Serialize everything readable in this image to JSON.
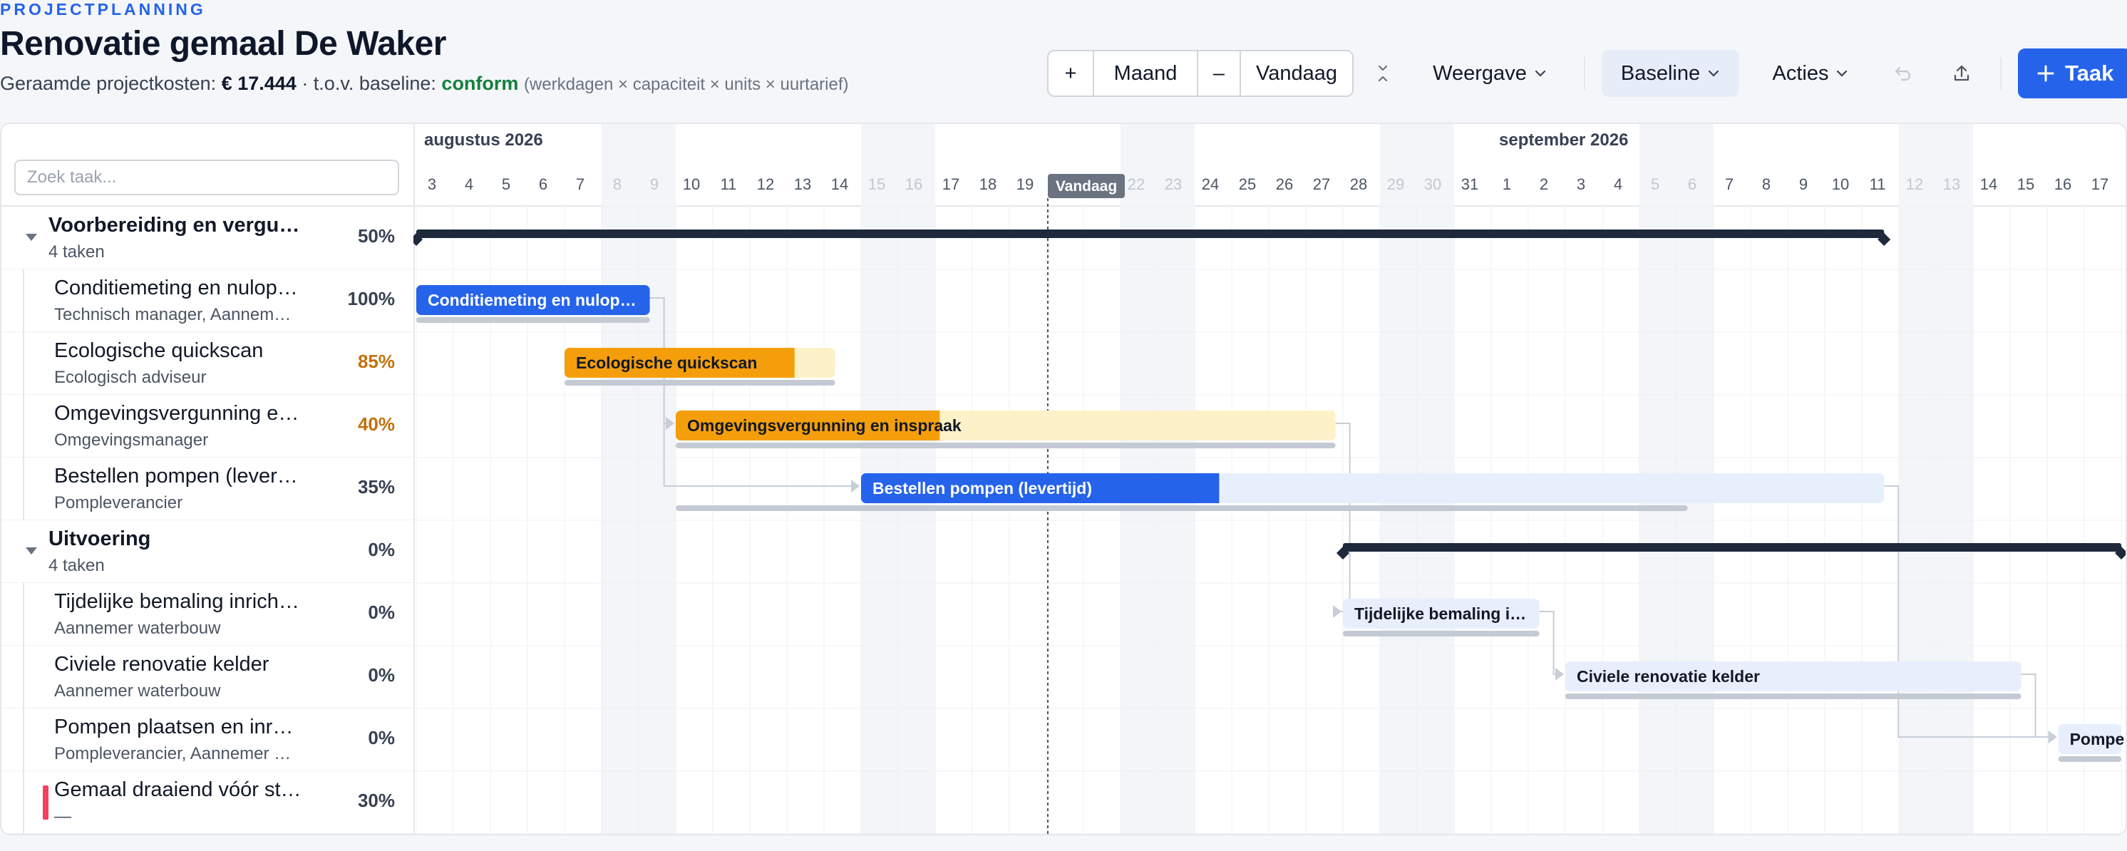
{
  "header": {
    "eyebrow": "PROJECTPLANNING",
    "title": "Renovatie gemaal De Waker",
    "cost_label": "Geraamde projectkosten:",
    "cost_value": "€ 17.444",
    "baseline_prefix": "· t.o.v. baseline:",
    "baseline_status": "conform",
    "formula_hint": "(werkdagen × capaciteit × units × uurtarief)"
  },
  "toolbar": {
    "zoom_in": "+",
    "zoom_level": "Maand",
    "zoom_out": "–",
    "today": "Vandaag",
    "view": "Weergave",
    "baseline": "Baseline",
    "actions": "Acties",
    "add_task": "Taak"
  },
  "search": {
    "placeholder": "Zoek taak..."
  },
  "rows": [
    {
      "kind": "group",
      "name": "Voorbereiding en vergun…",
      "sub": "4 taken",
      "pct": "50%",
      "pct_color": "#374151"
    },
    {
      "kind": "task",
      "name": "Conditiemeting en nulop…",
      "sub": "Technisch manager, Aannem…",
      "pct": "100%",
      "pct_color": "#374151"
    },
    {
      "kind": "task",
      "name": "Ecologische quickscan",
      "sub": "Ecologisch adviseur",
      "pct": "85%",
      "pct_color": "#c2710c"
    },
    {
      "kind": "task",
      "name": "Omgevingsvergunning e…",
      "sub": "Omgevingsmanager",
      "pct": "40%",
      "pct_color": "#c2710c"
    },
    {
      "kind": "task",
      "name": "Bestellen pompen (lever…",
      "sub": "Pompleverancier",
      "pct": "35%",
      "pct_color": "#374151"
    },
    {
      "kind": "group",
      "name": "Uitvoering",
      "sub": "4 taken",
      "pct": "0%",
      "pct_color": "#374151"
    },
    {
      "kind": "task",
      "name": "Tijdelijke bemaling inrich…",
      "sub": "Aannemer waterbouw",
      "pct": "0%",
      "pct_color": "#374151"
    },
    {
      "kind": "task",
      "name": "Civiele renovatie kelder",
      "sub": "Aannemer waterbouw",
      "pct": "0%",
      "pct_color": "#374151"
    },
    {
      "kind": "task",
      "name": "Pompen plaatsen en inre…",
      "sub": "Pompleverancier, Aannemer …",
      "pct": "0%",
      "pct_color": "#374151"
    },
    {
      "kind": "milestone",
      "name": "Gemaal draaiend vóór st…",
      "sub": "—",
      "pct": "30%",
      "pct_color": "#374151"
    }
  ],
  "timeline": {
    "months": [
      {
        "label": "augustus 2026",
        "start_index": 0
      },
      {
        "label": "september 2026",
        "start_index": 29
      }
    ],
    "days": [
      "3",
      "4",
      "5",
      "6",
      "7",
      "8",
      "9",
      "10",
      "11",
      "12",
      "13",
      "14",
      "15",
      "16",
      "17",
      "18",
      "19",
      "20",
      "21",
      "22",
      "23",
      "24",
      "25",
      "26",
      "27",
      "28",
      "29",
      "30",
      "31",
      "1",
      "2",
      "3",
      "4",
      "5",
      "6",
      "7",
      "8",
      "9",
      "10",
      "11",
      "12",
      "13",
      "14",
      "15",
      "16",
      "17"
    ],
    "weekend_indices": [
      5,
      6,
      12,
      13,
      19,
      20,
      26,
      27,
      33,
      34,
      40,
      41
    ],
    "today_index": 17,
    "today_label": "Vandaag",
    "bars": [
      {
        "row": 0,
        "type": "summary",
        "start": 0,
        "end": 39.6
      },
      {
        "row": 1,
        "type": "task",
        "label": "Conditiemeting en nulop…",
        "start": 0,
        "end": 6.3,
        "progress": 1.0,
        "fill": "#2563eb",
        "track": "#e8effc",
        "text_color": "#ffffff",
        "baseline_start": 0,
        "baseline_end": 6.3
      },
      {
        "row": 2,
        "type": "task",
        "label": "Ecologische quickscan",
        "start": 4,
        "end": 11.3,
        "progress": 0.85,
        "fill": "#f59e0b",
        "track": "#fdf1c8",
        "text_color": "#111827",
        "baseline_start": 4,
        "baseline_end": 11.3
      },
      {
        "row": 3,
        "type": "task",
        "label": "Omgevingsvergunning en inspraak",
        "start": 7,
        "end": 24.8,
        "progress": 0.4,
        "fill": "#f59e0b",
        "track": "#fdf1c8",
        "text_color": "#111827",
        "baseline_start": 7,
        "baseline_end": 24.8
      },
      {
        "row": 4,
        "type": "task",
        "label": "Bestellen pompen (levertijd)",
        "start": 12,
        "end": 39.6,
        "progress": 0.35,
        "fill": "#2563eb",
        "track": "#e8effc",
        "text_color": "#ffffff",
        "baseline_start": 7,
        "baseline_end": 34.3
      },
      {
        "row": 5,
        "type": "summary",
        "start": 25,
        "end": 46
      },
      {
        "row": 6,
        "type": "task",
        "label": "Tijdelijke bemaling i…",
        "start": 25,
        "end": 30.3,
        "progress": 0,
        "fill": "#2563eb",
        "track": "#e8effc",
        "text_color": "#111827",
        "baseline_start": 25,
        "baseline_end": 30.3
      },
      {
        "row": 7,
        "type": "task",
        "label": "Civiele renovatie kelder",
        "start": 31,
        "end": 43.3,
        "progress": 0,
        "fill": "#2563eb",
        "track": "#e8effc",
        "text_color": "#111827",
        "baseline_start": 31,
        "baseline_end": 43.3
      },
      {
        "row": 8,
        "type": "task",
        "label": "Pompe",
        "start": 44.3,
        "end": 46,
        "progress": 0,
        "fill": "#2563eb",
        "track": "#e8effc",
        "text_color": "#111827",
        "baseline_start": 44.3,
        "baseline_end": 46
      }
    ],
    "dependencies": [
      {
        "from_row": 1,
        "to_row": 3,
        "from_end": 6.3,
        "to_start": 7
      },
      {
        "from_row": 1,
        "to_row": 4,
        "from_end": 6.3,
        "to_start": 12
      },
      {
        "from_row": 3,
        "to_row": 6,
        "from_end": 24.8,
        "to_start": 25
      },
      {
        "from_row": 6,
        "to_row": 7,
        "from_end": 30.3,
        "to_start": 31
      },
      {
        "from_row": 7,
        "to_row": 8,
        "from_end": 43.3,
        "to_start": 44.3
      },
      {
        "from_row": 4,
        "to_row": 8,
        "from_end": 39.6,
        "to_start": 44.3
      }
    ]
  }
}
